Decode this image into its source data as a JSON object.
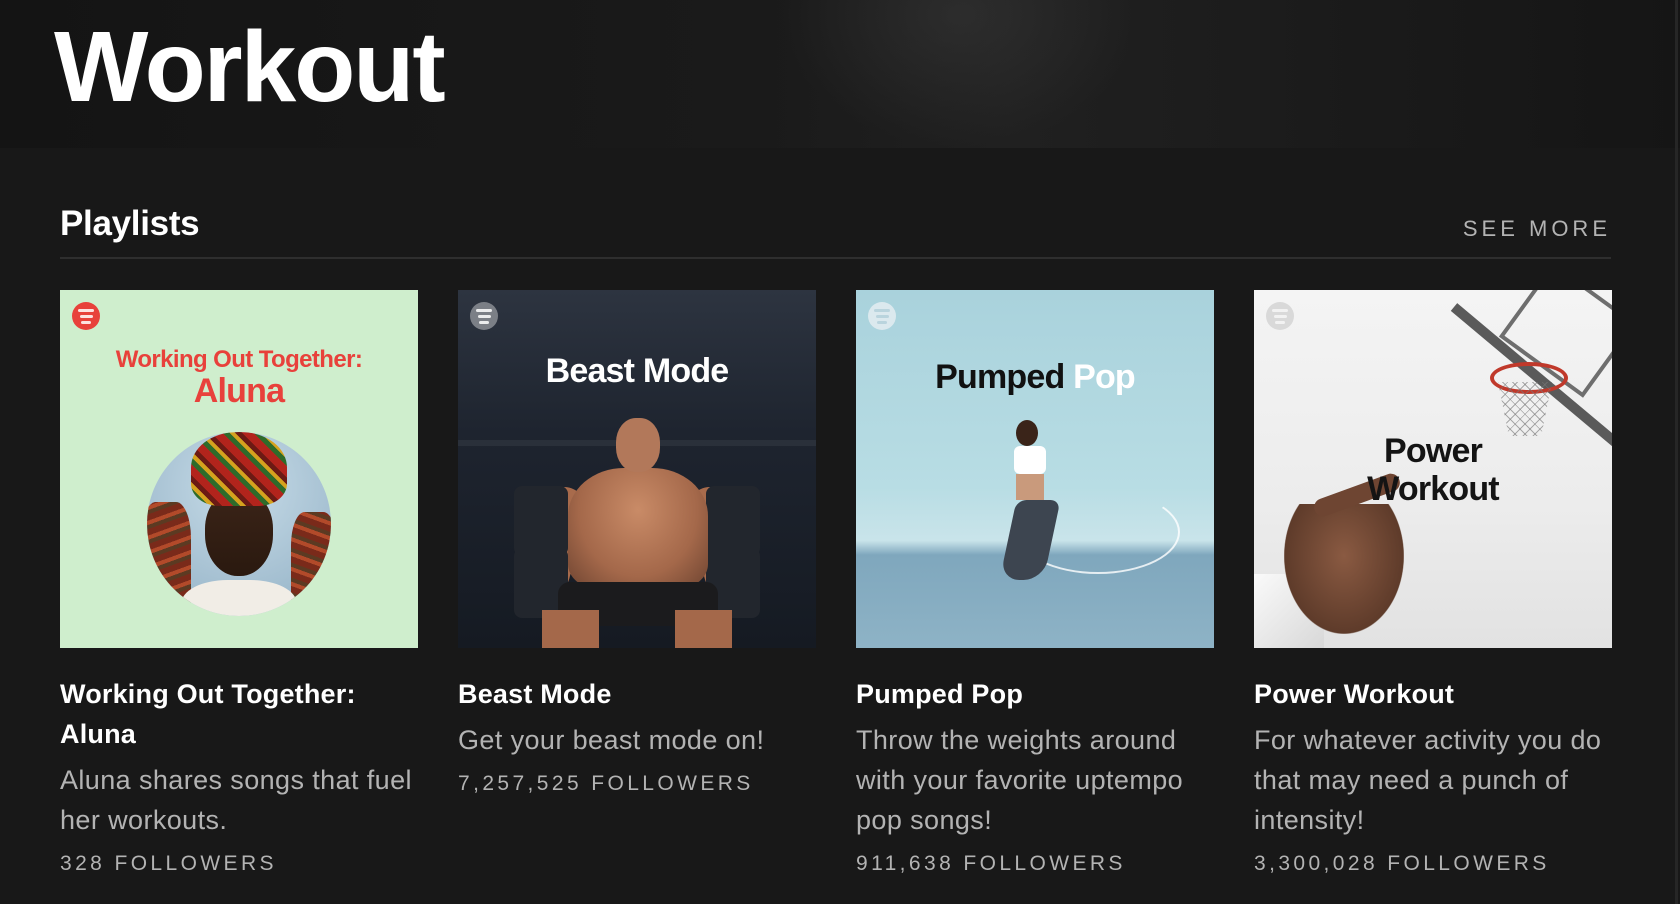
{
  "page": {
    "title": "Workout"
  },
  "section": {
    "title": "Playlists",
    "see_more": "SEE MORE"
  },
  "playlists": [
    {
      "art_line1": "Working Out Together:",
      "art_line2": "Aluna",
      "title": "Working Out Together: Aluna",
      "description": "Aluna shares songs that fuel her workouts.",
      "followers": "328 FOLLOWERS",
      "bg_color": "#cfeecd",
      "accent_color": "#e8413b"
    },
    {
      "art_title": "Beast Mode",
      "title": "Beast Mode",
      "description": "Get your beast mode on!",
      "followers": "7,257,525 FOLLOWERS"
    },
    {
      "art_title_a": "Pumped",
      "art_title_b": "Pop",
      "title": "Pumped Pop",
      "description": "Throw the weights around with your favorite uptempo pop songs!",
      "followers": "911,638 FOLLOWERS"
    },
    {
      "art_line1": "Power",
      "art_line2": "Workout",
      "title": "Power Workout",
      "description": "For whatever activity you do that may need a punch of intensity!",
      "followers": "3,300,028 FOLLOWERS"
    }
  ],
  "icons": {
    "logo": "spotify-icon"
  },
  "colors": {
    "background": "#181818",
    "text": "#ffffff",
    "muted": "#b3b3b3"
  }
}
